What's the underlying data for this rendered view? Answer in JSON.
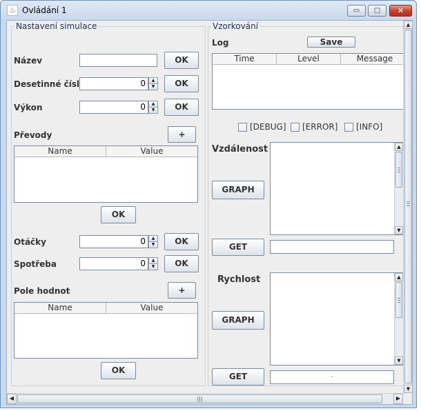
{
  "window": {
    "title": "Ovládání 1",
    "app_icon": "java-cup-icon",
    "min_glyph": "▭",
    "max_glyph": "□",
    "close_glyph": "✕"
  },
  "left_panel": {
    "title": "Nastavení simulace",
    "nazev": {
      "label": "Název",
      "value": "",
      "ok": "OK"
    },
    "desetinne": {
      "label": "Desetinné číslo",
      "value": "0",
      "ok": "OK"
    },
    "vykon": {
      "label": "Výkon",
      "value": "0",
      "ok": "OK"
    },
    "prevody": {
      "label": "Převody",
      "add": "+",
      "columns": [
        "Name",
        "Value"
      ],
      "ok": "OK"
    },
    "otacky": {
      "label": "Otáčky",
      "value": "0",
      "ok": "OK"
    },
    "spotreba": {
      "label": "Spotřeba",
      "value": "0",
      "ok": "OK"
    },
    "pole_hodnot": {
      "label": "Pole hodnot",
      "add": "+",
      "columns": [
        "Name",
        "Value"
      ],
      "ok": "OK"
    }
  },
  "right_panel": {
    "title": "Vzorkování",
    "log": {
      "label": "Log",
      "save": "Save",
      "columns": [
        "Time",
        "Level",
        "Message"
      ]
    },
    "filters": [
      {
        "label": "[DEBUG]",
        "checked": false
      },
      {
        "label": "[ERROR]",
        "checked": false
      },
      {
        "label": "[INFO]",
        "checked": false
      }
    ],
    "vzdalenost": {
      "label": "Vzdálenost",
      "graph": "GRAPH",
      "get": "GET",
      "value": ""
    },
    "rychlost": {
      "label": "Rychlost",
      "graph": "GRAPH",
      "get": "GET",
      "value": "."
    }
  },
  "scroll": {
    "up": "▲",
    "down": "▼",
    "left": "◀",
    "right": "▶",
    "grip": "|||"
  },
  "colors": {
    "panel_bg": "#eeeeee",
    "close_red": "#c4402e",
    "title_bg": "#dfe9f5"
  }
}
